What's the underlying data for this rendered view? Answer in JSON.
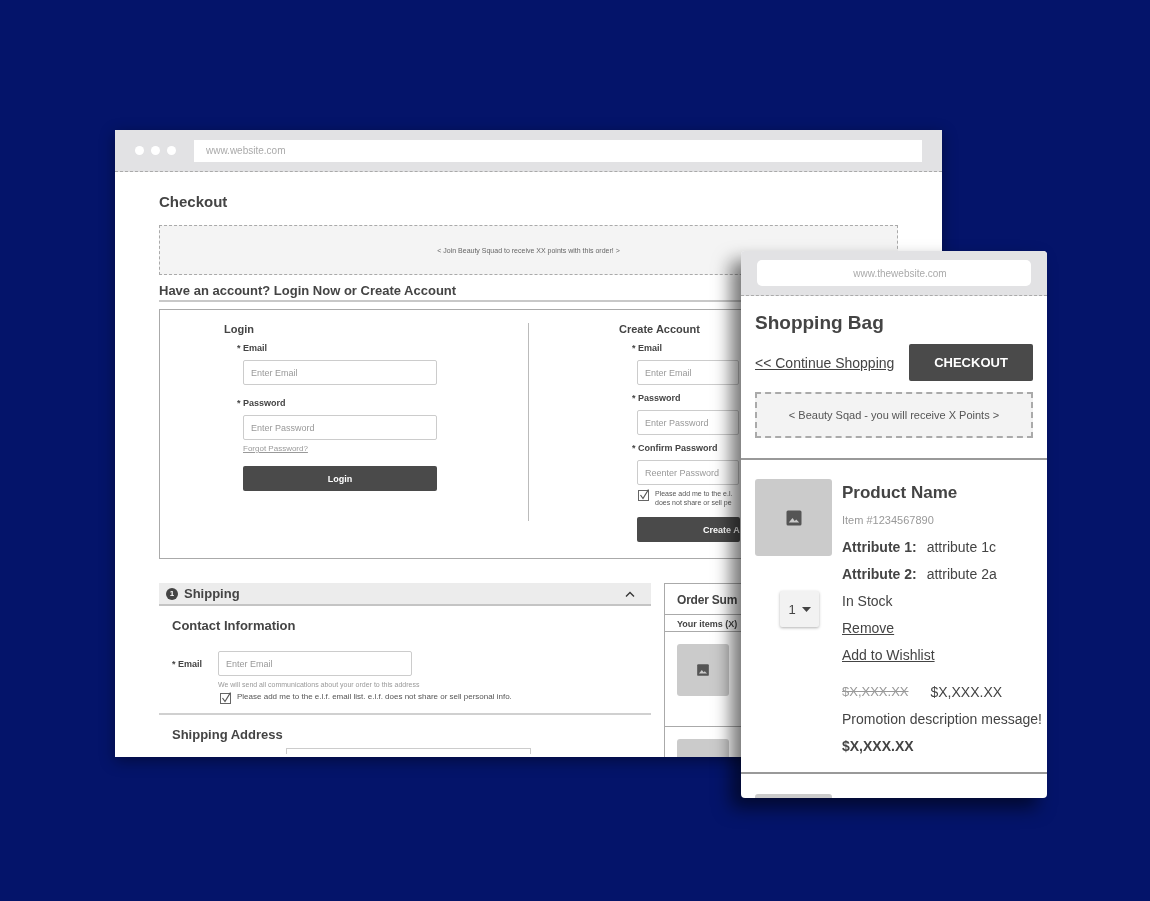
{
  "desktop_window": {
    "url": "www.website.com",
    "page_title": "Checkout",
    "promo": "< Join Beauty Squad to receive XX points with this order! >",
    "account_heading": "Have an account? Login Now or Create Account",
    "login": {
      "title": "Login",
      "fields": [
        {
          "label": "* Email",
          "placeholder": "Enter Email"
        },
        {
          "label": "* Password",
          "placeholder": "Enter Password"
        }
      ],
      "forgot_link": "Forgot Password?",
      "button": "Login"
    },
    "create_account": {
      "title": "Create Account",
      "fields": [
        {
          "label": "* Email",
          "placeholder": "Enter Email"
        },
        {
          "label": "* Password",
          "placeholder": "Enter Password"
        },
        {
          "label": "* Confirm Password",
          "placeholder": "Reenter Password"
        }
      ],
      "opt_in": {
        "checked": true,
        "lines": [
          "Please add me to the e.l.",
          "does not share or sell pe"
        ]
      },
      "button": "Create A"
    },
    "shipping": {
      "step": "1",
      "title": "Shipping",
      "expanded": true,
      "contact_heading": "Contact Information",
      "email": {
        "label": "* Email",
        "placeholder": "Enter Email",
        "hint": "We will send all communications about your order to this address"
      },
      "opt_in": {
        "checked": true,
        "text": "Please add me to the e.l.f. email list. e.l.f. does not share or sell personal info."
      },
      "address_heading": "Shipping Address"
    },
    "order_summary": {
      "title": "Order Sum",
      "items_label": "Your items (X)",
      "thumbnails": [
        {
          "kind": "image-placeholder"
        },
        {
          "kind": "image-placeholder"
        }
      ]
    }
  },
  "mobile_window": {
    "url": "www.thewebsite.com",
    "title": "Shopping Bag",
    "continue_link": "<< Continue Shopping",
    "checkout_button": "CHECKOUT",
    "promo": "< Beauty Sqad - you will receive X Points >",
    "products": [
      {
        "name": "Product Name",
        "item_number": "Item #1234567890",
        "attributes": [
          {
            "label": "Attribute 1:",
            "value": "attribute 1c"
          },
          {
            "label": "Attribute 2:",
            "value": "attribute 2a"
          }
        ],
        "quantity": "1",
        "stock": "In Stock",
        "remove_link": "Remove",
        "wishlist_link": "Add to Wishlist",
        "original_price": "$X,XXX.XX",
        "sale_price": "$X,XXX.XX",
        "promotion": "Promotion description message!",
        "total": "$X,XXX.XX"
      }
    ]
  }
}
